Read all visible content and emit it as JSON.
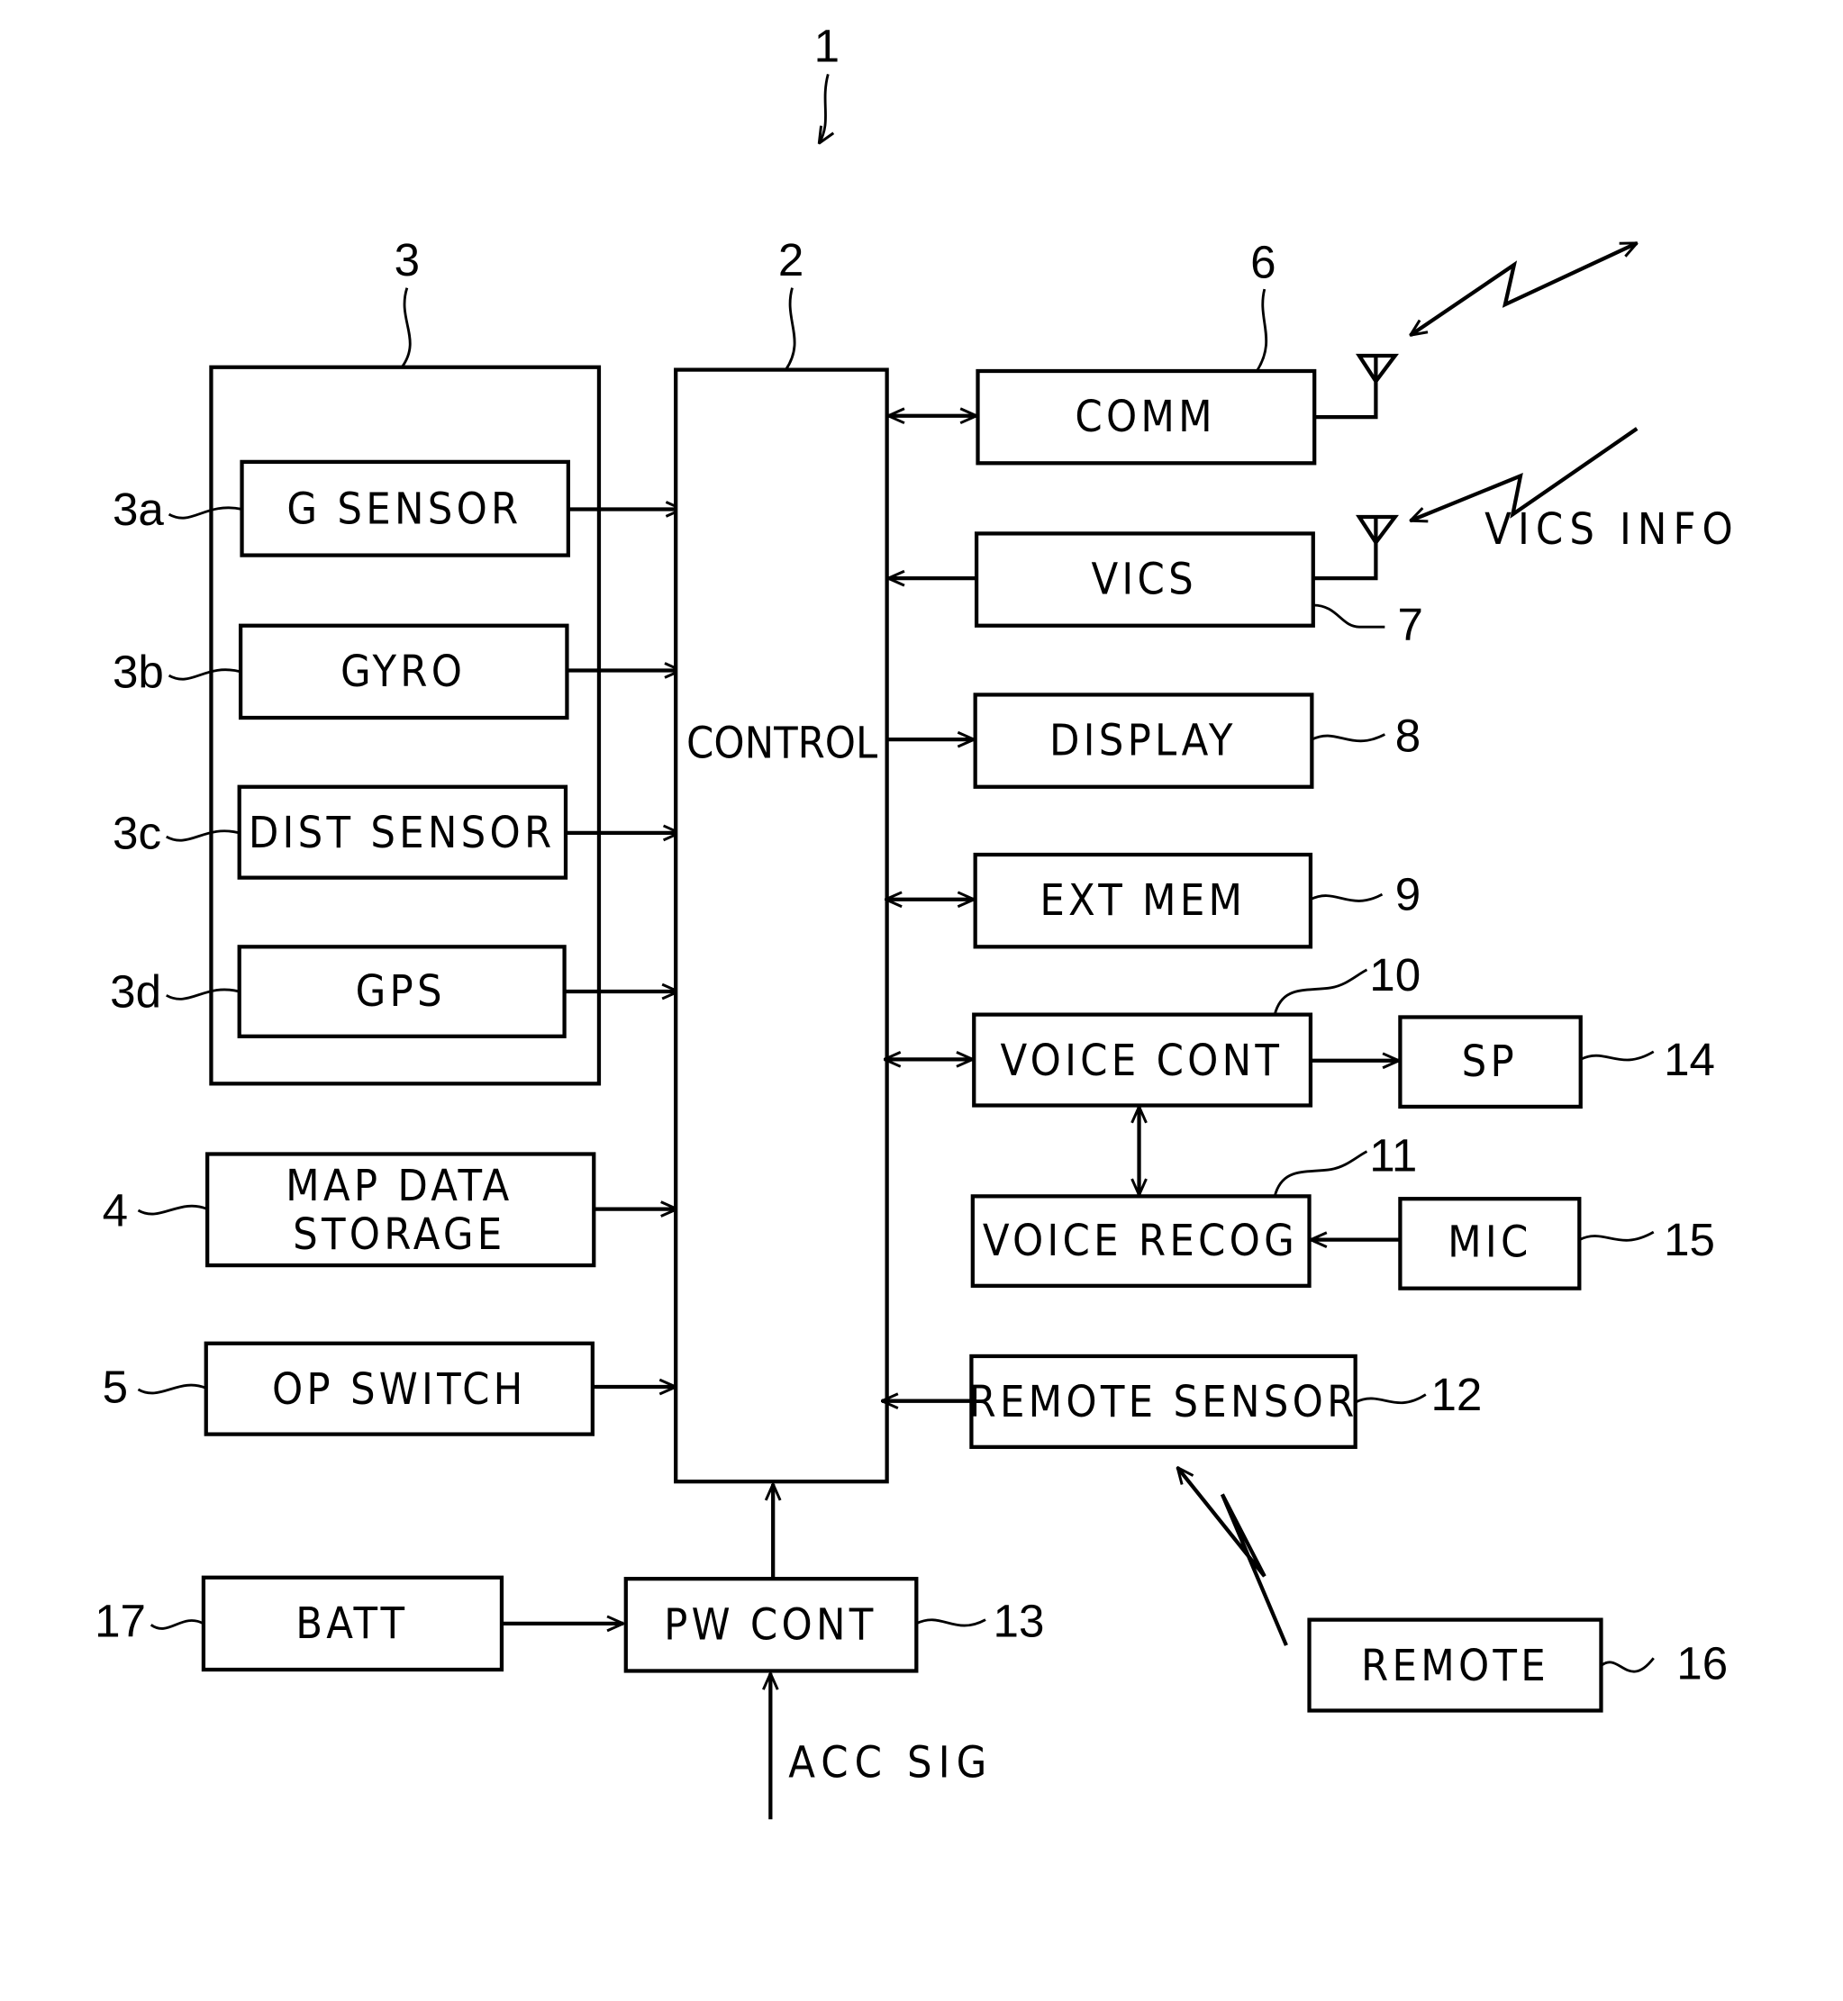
{
  "figure": {
    "system_ref": "1",
    "blocks": {
      "control": {
        "ref": "2",
        "label": "CONTROL"
      },
      "sensor_group": {
        "ref": "3"
      },
      "g_sensor": {
        "ref": "3a",
        "label": "G SENSOR"
      },
      "gyro": {
        "ref": "3b",
        "label": "GYRO"
      },
      "dist_sensor": {
        "ref": "3c",
        "label": "DIST SENSOR"
      },
      "gps": {
        "ref": "3d",
        "label": "GPS"
      },
      "map_data": {
        "ref": "4",
        "label_line1": "MAP DATA",
        "label_line2": "STORAGE"
      },
      "op_switch": {
        "ref": "5",
        "label": "OP SWITCH"
      },
      "comm": {
        "ref": "6",
        "label": "COMM"
      },
      "vics": {
        "ref": "7",
        "label": "VICS"
      },
      "display": {
        "ref": "8",
        "label": "DISPLAY"
      },
      "ext_mem": {
        "ref": "9",
        "label": "EXT MEM"
      },
      "voice_cont": {
        "ref": "10",
        "label": "VOICE CONT"
      },
      "voice_recog": {
        "ref": "11",
        "label": "VOICE RECOG"
      },
      "remote_sensor": {
        "ref": "12",
        "label": "REMOTE SENSOR"
      },
      "pw_cont": {
        "ref": "13",
        "label": "PW CONT"
      },
      "sp": {
        "ref": "14",
        "label": "SP"
      },
      "mic": {
        "ref": "15",
        "label": "MIC"
      },
      "remote": {
        "ref": "16",
        "label": "REMOTE"
      },
      "batt": {
        "ref": "17",
        "label": "BATT"
      }
    },
    "annotations": {
      "vics_info": "VICS INFO",
      "acc_sig": "ACC SIG"
    }
  }
}
